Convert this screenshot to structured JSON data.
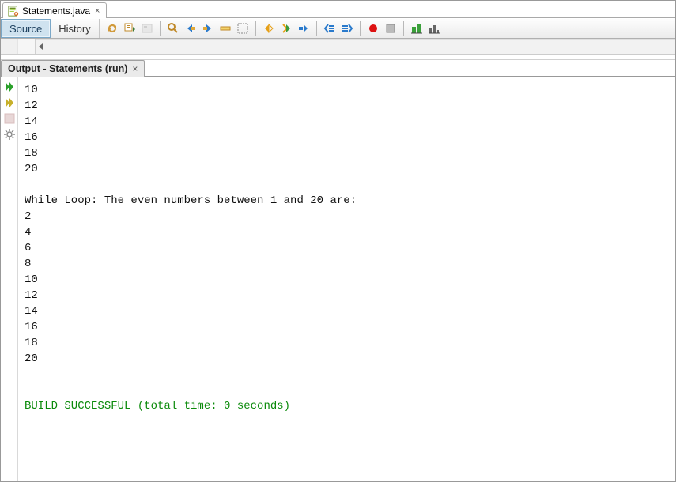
{
  "file_tab": {
    "label": "Statements.java",
    "close": "×"
  },
  "view_tabs": {
    "source": "Source",
    "history": "History"
  },
  "toolbar_icons": {
    "refresh": "refresh-icon",
    "nav_dropdown": "nav-dropdown-icon",
    "prev_bookmark": "prev-bookmark-icon",
    "find_selection": "find-selection-icon",
    "find_prev": "find-prev-icon",
    "find_next": "find-next-icon",
    "toggle_highlight": "toggle-highlight-icon",
    "toggle_rect": "toggle-rect-icon",
    "shift_left": "shift-left-icon",
    "shift_right": "shift-right-icon",
    "shift_line": "shift-line-icon",
    "comment": "comment-icon",
    "uncomment": "uncomment-icon",
    "record": "record-icon",
    "stop": "stop-icon",
    "diff": "diff-icon",
    "bars": "bars-icon"
  },
  "output": {
    "title": "Output - Statements (run)",
    "close": "×",
    "side_buttons": [
      "run-green-icon",
      "run-yellow-icon",
      "stop-square-icon",
      "settings-icon"
    ],
    "lines": [
      "10",
      "12",
      "14",
      "16",
      "18",
      "20",
      "",
      "While Loop: The even numbers between 1 and 20 are:",
      "2",
      "4",
      "6",
      "8",
      "10",
      "12",
      "14",
      "16",
      "18",
      "20",
      "",
      ""
    ],
    "build_line": "BUILD SUCCESSFUL (total time: 0 seconds)"
  }
}
